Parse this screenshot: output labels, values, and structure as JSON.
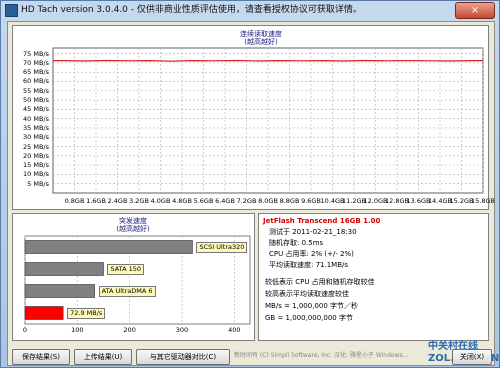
{
  "window": {
    "title": "HD Tach version 3.0.4.0  - 仅供非商业性质评估使用，请查看授权协议可获取详情。",
    "close_glyph": "×"
  },
  "read_chart": {
    "title": "连续读取速度",
    "subtitle": "(越高越好)"
  },
  "burst_chart": {
    "title": "突发速度",
    "subtitle": "(越高越好)"
  },
  "chart_data": [
    {
      "type": "line",
      "title": "连续读取速度",
      "subtitle": "(越高越好)",
      "x": [
        "0.8GB",
        "1.6GB",
        "2.4GB",
        "3.2GB",
        "4.0GB",
        "4.8GB",
        "5.6GB",
        "6.4GB",
        "7.2GB",
        "8.0GB",
        "8.8GB",
        "9.6GB",
        "10.4GB",
        "11.2GB",
        "12.0GB",
        "12.8GB",
        "13.6GB",
        "14.4GB",
        "15.2GB",
        "15.8GB"
      ],
      "yticks": [
        "75 MB/s",
        "70 MB/s",
        "65 MB/s",
        "60 MB/s",
        "55 MB/s",
        "50 MB/s",
        "45 MB/s",
        "40 MB/s",
        "35 MB/s",
        "30 MB/s",
        "25 MB/s",
        "20 MB/s",
        "15 MB/s",
        "10 MB/s",
        "5 MB/s"
      ],
      "ylim": [
        0,
        78
      ],
      "series": [
        {
          "values": [
            71.2,
            71.0,
            71.3,
            71.1,
            71.2,
            70.9,
            71.2,
            71.1,
            71.3,
            71.0,
            71.2,
            71.1,
            71.2,
            71.0,
            71.3,
            71.1,
            71.2,
            71.1,
            71.0,
            71.2
          ],
          "color": "#d42020"
        }
      ],
      "grid": true
    },
    {
      "type": "bar",
      "title": "突发速度",
      "subtitle": "(越高越好)",
      "orientation": "horizontal",
      "categories": [
        "SCSI Ultra320",
        "SATA 150",
        "ATA UltraDMA 6",
        "72.9 MB/s"
      ],
      "values": [
        320,
        150,
        133,
        72.9
      ],
      "colors": [
        "#808080",
        "#808080",
        "#808080",
        "#ff0000"
      ],
      "xticks": [
        "0",
        "100",
        "200",
        "300",
        "400"
      ],
      "xlim": [
        0,
        430
      ],
      "grid": true
    }
  ],
  "info": {
    "drive_name": "JetFlash Transcend 16GB 1.00",
    "test_date": "测试于  2011-02-21_18:30",
    "random_access": "随机存取:  0.5ms",
    "cpu_usage": "CPU 占用率:  2% (+/- 2%)",
    "avg_read": "平均读取速度:  71.1MB/s",
    "note_cpu": "较低表示 CPU 占用和随机存取较佳",
    "note_read": "较高表示平均读取速度较佳",
    "unit_mb": "MB/s = 1,000,000 字节／秒",
    "unit_gb": "GB = 1,000,000,000 字节"
  },
  "buttons": {
    "save": "保存结果(S)",
    "upload": "上传结果(U)",
    "compare": "与其它驱动器对比(C)",
    "close": "关闭(X)"
  },
  "footer": "新时间有 (C) Simpli Software, Inc. 汉化: 雅星小子 Windows...",
  "watermark": "中关村在线 ZOL.COM.CN"
}
